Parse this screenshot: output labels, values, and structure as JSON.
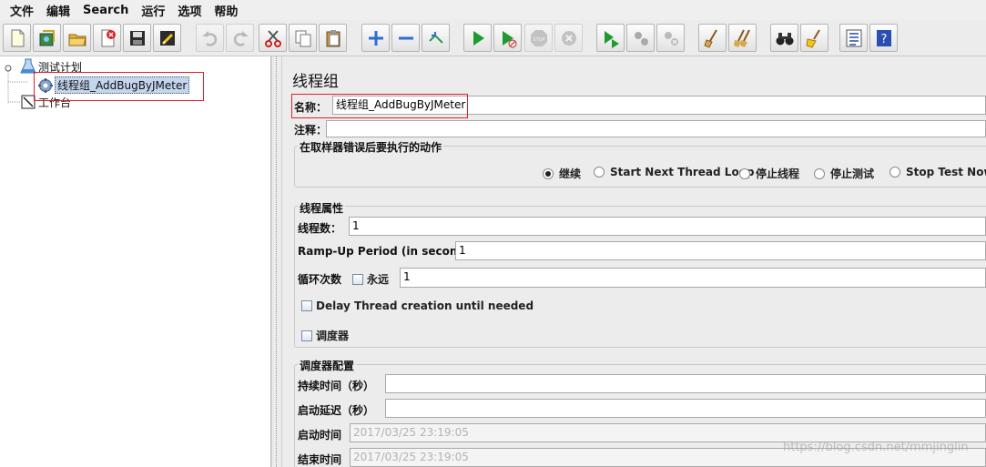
{
  "menu": [
    "文件",
    "编辑",
    "Search",
    "运行",
    "选项",
    "帮助"
  ],
  "toolbar": {
    "buttons": [
      {
        "icon": "new-icon",
        "enabled": true
      },
      {
        "icon": "templates-icon",
        "enabled": true
      },
      {
        "icon": "open-icon",
        "enabled": true
      },
      {
        "icon": "close-icon",
        "enabled": true
      },
      {
        "icon": "save-icon",
        "enabled": true
      },
      {
        "icon": "save-snapshot-icon",
        "enabled": true
      },
      {
        "icon": "undo-icon",
        "enabled": false
      },
      {
        "icon": "redo-icon",
        "enabled": false
      },
      {
        "icon": "cut-icon",
        "enabled": true
      },
      {
        "icon": "copy-icon",
        "enabled": true
      },
      {
        "icon": "paste-icon",
        "enabled": true
      },
      {
        "icon": "expand-icon",
        "enabled": true
      },
      {
        "icon": "collapse-icon",
        "enabled": true
      },
      {
        "icon": "toggle-icon",
        "enabled": true
      },
      {
        "icon": "start-icon",
        "enabled": true
      },
      {
        "icon": "start-no-pause-icon",
        "enabled": true
      },
      {
        "icon": "stop-icon",
        "enabled": false
      },
      {
        "icon": "shutdown-icon",
        "enabled": false
      },
      {
        "icon": "remote-start-icon",
        "enabled": true
      },
      {
        "icon": "remote-stop-icon",
        "enabled": true
      },
      {
        "icon": "remote-shutdown-icon",
        "enabled": true
      },
      {
        "icon": "clear-icon",
        "enabled": true
      },
      {
        "icon": "clear-all-icon",
        "enabled": true
      },
      {
        "icon": "search-binoculars-icon",
        "enabled": true
      },
      {
        "icon": "reset-search-icon",
        "enabled": true
      },
      {
        "icon": "function-helper-icon",
        "enabled": true
      },
      {
        "icon": "help-icon",
        "enabled": true
      }
    ]
  },
  "tree": {
    "root": "测试计划",
    "thread_group": "线程组_AddBugByJMeter",
    "workbench": "工作台"
  },
  "panel": {
    "title": "线程组",
    "name_label": "名称：",
    "name_value": "线程组_AddBugByJMeter",
    "comment_label": "注释：",
    "comment_value": "",
    "on_error": {
      "title": "在取样器错误后要执行的动作",
      "options": [
        "继续",
        "Start Next Thread Loop",
        "停止线程",
        "停止测试",
        "Stop Test Now"
      ],
      "selected": "继续"
    },
    "thread_props": {
      "title": "线程属性",
      "threads_label": "线程数：",
      "threads_value": "1",
      "rampup_label": "Ramp-Up Period (in seconds):",
      "rampup_value": "1",
      "loop_label": "循环次数",
      "forever_label": "永远",
      "forever_checked": false,
      "loop_value": "1",
      "delay_label": "Delay Thread creation until needed",
      "delay_checked": false,
      "scheduler_label": "调度器",
      "scheduler_checked": false
    },
    "scheduler": {
      "title": "调度器配置",
      "duration_label": "持续时间（秒）",
      "duration_value": "",
      "delay_label": "启动延迟（秒）",
      "delay_value": "",
      "start_label": "启动时间",
      "start_value": "2017/03/25 23:19:05",
      "end_label": "结束时间",
      "end_value": "2017/03/25 23:19:05"
    }
  },
  "watermark": "https://blog.csdn.net/mmjinglin",
  "colors": {
    "selection": "#c4d6ee",
    "highlight_box": "#e0202a"
  }
}
